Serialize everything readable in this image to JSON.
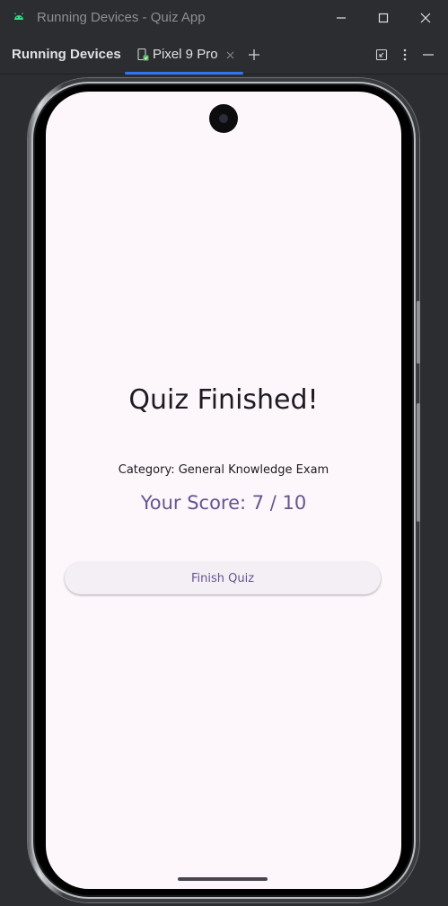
{
  "window": {
    "title": "Running Devices - Quiz App",
    "controls": [
      "minimize-icon",
      "maximize-icon",
      "close-icon"
    ]
  },
  "toolbar": {
    "tool_window_title": "Running Devices",
    "tab": {
      "label": "Pixel 9 Pro",
      "icon": "device-icon",
      "close_icon": "close-icon"
    },
    "add_tab_icon": "plus-icon",
    "actions": [
      "restore-icon",
      "more-vert-icon",
      "hide-icon"
    ],
    "accent_color": "#3574f0"
  },
  "device_screen": {
    "title": "Quiz Finished!",
    "category": "Category: General Knowledge Exam",
    "score": "Your Score: 7 / 10",
    "finish_button_label": "Finish Quiz",
    "background_color": "#fdf7fb",
    "score_color": "#65558f"
  }
}
